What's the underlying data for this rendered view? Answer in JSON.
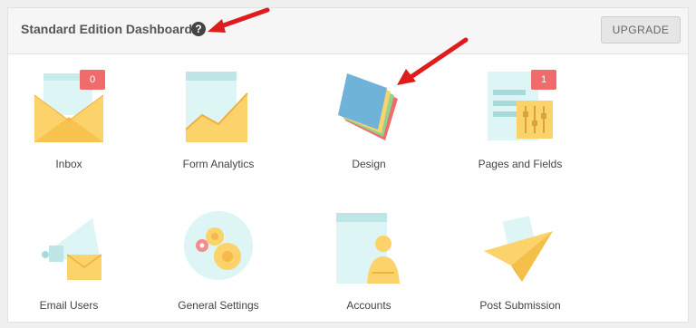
{
  "header": {
    "title": "Standard Edition Dashboard",
    "help_glyph": "?",
    "upgrade_label": "UPGRADE"
  },
  "tiles": [
    {
      "label": "Inbox",
      "badge": "0",
      "icon": "envelope-icon"
    },
    {
      "label": "Form Analytics",
      "icon": "analytics-chart-icon"
    },
    {
      "label": "Design",
      "icon": "color-swatches-icon"
    },
    {
      "label": "Pages and Fields",
      "badge": "1",
      "icon": "pages-fields-icon"
    },
    {
      "label": "Email Users",
      "icon": "megaphone-mail-icon"
    },
    {
      "label": "General Settings",
      "icon": "gears-icon"
    },
    {
      "label": "Accounts",
      "icon": "user-account-icon"
    },
    {
      "label": "Post Submission",
      "icon": "paper-plane-icon"
    }
  ],
  "colors": {
    "badge": "#f06b6b",
    "arrow": "#e01b1b",
    "icon_yellow": "#fcd26b",
    "icon_light_blue": "#ddf5f5"
  }
}
